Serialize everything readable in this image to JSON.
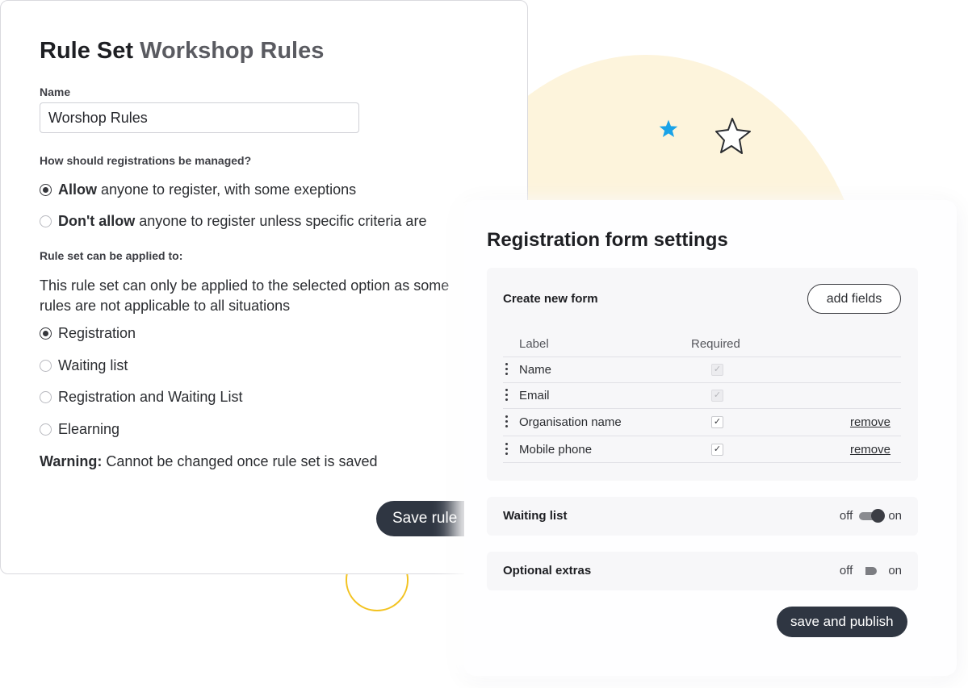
{
  "rule_set": {
    "title_prefix": "Rule Set",
    "title_name": "Workshop Rules",
    "name_label": "Name",
    "name_value": "Worshop Rules",
    "manage_question": "How should registrations be managed?",
    "manage_options": [
      {
        "bold": "Allow",
        "text": " anyone to register, with some exeptions",
        "selected": true
      },
      {
        "bold": "Don't allow",
        "text": " anyone to register unless specific criteria are",
        "selected": false
      }
    ],
    "applied_label": "Rule set can be applied to:",
    "applied_desc": "This rule set can only be applied to the selected option as some rules are not applicable to all situations",
    "applied_options": [
      {
        "label": "Registration",
        "selected": true
      },
      {
        "label": "Waiting list",
        "selected": false
      },
      {
        "label": "Registration and Waiting List",
        "selected": false
      },
      {
        "label": "Elearning",
        "selected": false
      }
    ],
    "warning_bold": "Warning:",
    "warning_text": " Cannot be changed once rule set is saved",
    "save_button": "Save rule"
  },
  "form_settings": {
    "title": "Registration form settings",
    "create_form_label": "Create new form",
    "add_fields_button": "add fields",
    "columns": {
      "label": "Label",
      "required": "Required"
    },
    "fields": [
      {
        "label": "Name",
        "required": true,
        "locked": true,
        "remove": ""
      },
      {
        "label": "Email",
        "required": true,
        "locked": true,
        "remove": ""
      },
      {
        "label": "Organisation name",
        "required": true,
        "locked": false,
        "remove": "remove"
      },
      {
        "label": "Mobile phone",
        "required": true,
        "locked": false,
        "remove": "remove"
      }
    ],
    "waiting_list": {
      "label": "Waiting list",
      "off": "off",
      "on": "on",
      "enabled": true
    },
    "optional_extras": {
      "label": "Optional extras",
      "off": "off",
      "on": "on",
      "enabled": false
    },
    "publish_button": "save and publish"
  },
  "colors": {
    "dark_button": "#2f3642",
    "accent_star": "#1aa3e8",
    "ring": "#f3c321",
    "blob": "#fdf4dc"
  }
}
